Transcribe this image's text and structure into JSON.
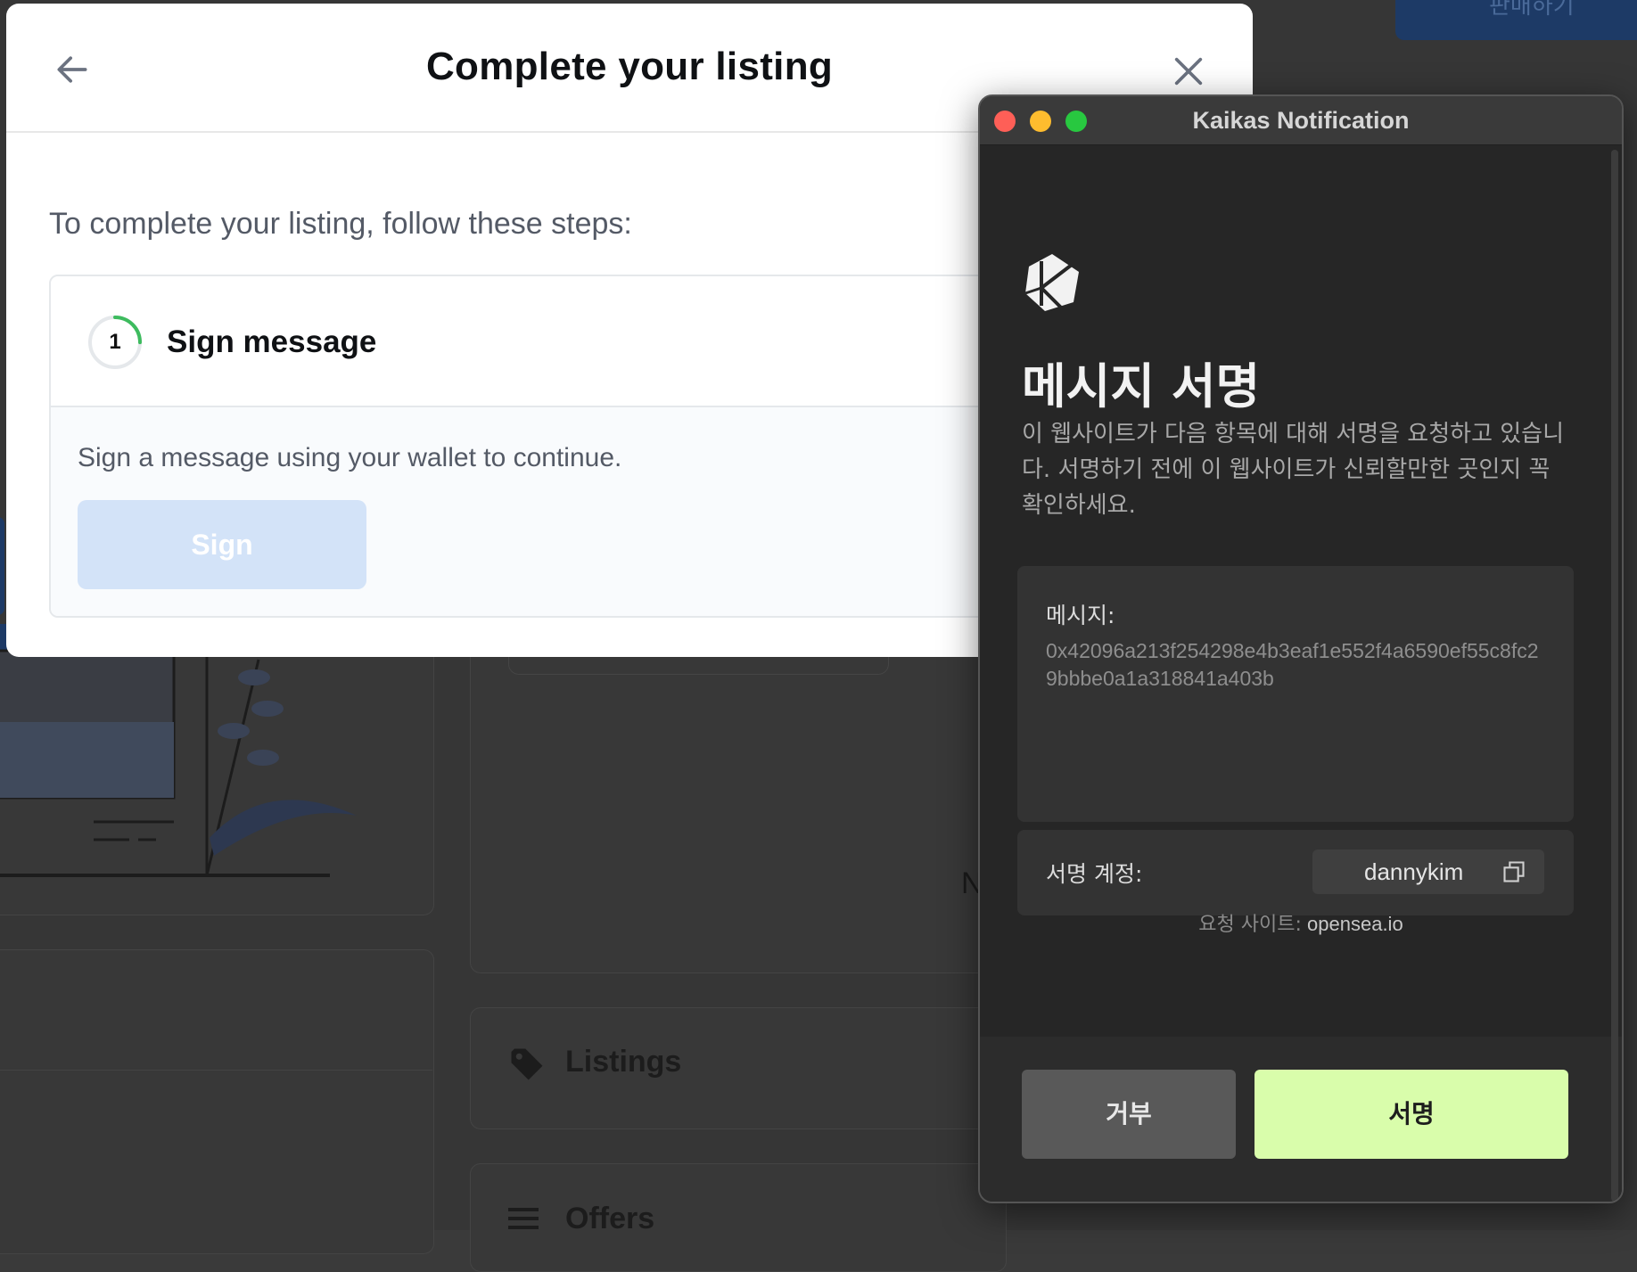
{
  "background": {
    "top_button_label": "판매하기",
    "listings_label": "Listings",
    "offers_label": "Offers",
    "partial_letter": "N"
  },
  "modal": {
    "title": "Complete your listing",
    "intro": "To complete your listing, follow these steps:",
    "step": {
      "number": "1",
      "title": "Sign message",
      "description": "Sign a message using your wallet to continue.",
      "button_label": "Sign",
      "progress": 0.25
    }
  },
  "kaikas": {
    "window_title": "Kaikas Notification",
    "heading": "메시지 서명",
    "description": "이 웹사이트가 다음 항목에 대해 서명을 요청하고 있습니다. 서명하기 전에 이 웹사이트가 신뢰할만한 곳인지 꼭 확인하세요.",
    "message_label": "메시지:",
    "message_value": "0x42096a213f254298e4b3eaf1e552f4a6590ef55c8fc29bbbe0a1a318841a403b",
    "account_label": "서명 계정:",
    "account_name": "dannykim",
    "site_label": "요청 사이트:",
    "site_value": "opensea.io",
    "reject_label": "거부",
    "sign_label": "서명"
  },
  "colors": {
    "sign_disabled": "#d3e3f8",
    "progress_ring": "#3dbb5e",
    "kaikas_sign": "#d9fdab",
    "kaikas_reject": "#595959"
  }
}
